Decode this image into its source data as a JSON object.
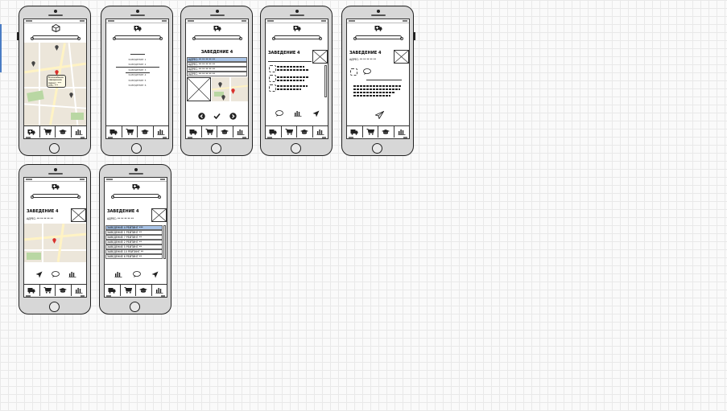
{
  "screens": {
    "venue_list": {
      "rows": [
        "ЗАВЕДЕНИЕ 1",
        "ЗАВЕДЕНИЕ 2",
        "ЗАВЕДЕНИЕ 3",
        "ЗАВЕДЕНИЕ 4",
        "ЗАВЕДЕНИЕ 5",
        "ЗАВЕДЕНИЕ 6"
      ]
    },
    "map_bubble": {
      "line1": "Ближайшее",
      "line2": "заведение",
      "line3": "Адрес: ***",
      "line4": "Info: ***"
    },
    "title": "ЗАВЕДЕНИЕ 4",
    "address_label": "АДРЕС:",
    "address_value": "** ** ** ** **",
    "selection": {
      "rows": [
        "АДРЕС: ** ** ** ** **",
        "АДРЕС: ** ** ** ** **",
        "АДРЕС: ** ** ** ** **",
        "АДРЕС: ** ** ** ** **"
      ]
    },
    "ranking": {
      "rows": [
        {
          "name": "ЗАВЕДЕНИЕ 4",
          "rating": "РЕЙТИНГ *** "
        },
        {
          "name": "ЗАВЕДЕНИЕ 1",
          "rating": "РЕЙТИНГ ** "
        },
        {
          "name": "ЗАВЕДЕНИЕ 7",
          "rating": "РЕЙТИНГ ** "
        },
        {
          "name": "ЗАВЕДЕНИЕ 2",
          "rating": "РЕЙТИНГ ** "
        },
        {
          "name": "ЗАВЕДЕНИЕ 5",
          "rating": "РЕЙТИНГ ** "
        },
        {
          "name": "ЗАВЕДЕНИЕ 10",
          "rating": "РЕЙТИНГ ** "
        },
        {
          "name": "ЗАВЕДЕНИЕ 6",
          "rating": "РЕЙТИНГ ** "
        }
      ]
    }
  },
  "tabbar": {
    "icons": [
      "ambulance-icon",
      "cart-icon",
      "graduation-cap-icon",
      "bar-chart-icon"
    ]
  },
  "colors": {
    "selection": "#a8c3e6",
    "pin": "#d9302c",
    "grid": "#e9e9e9"
  }
}
